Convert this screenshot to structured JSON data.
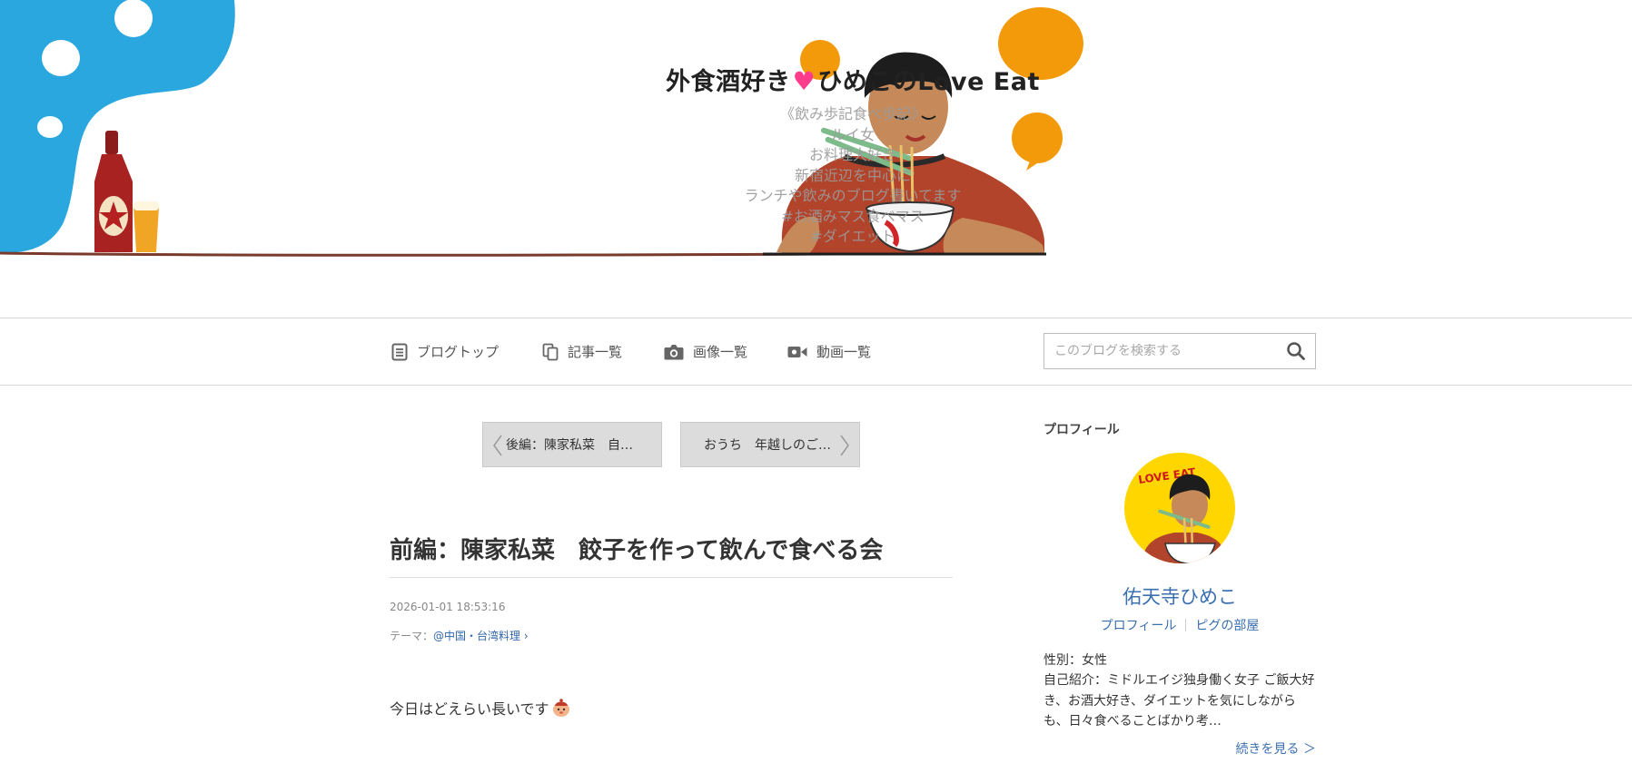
{
  "header": {
    "title_before": "外食酒好き",
    "title_heart": "♥",
    "title_after": "ひめこのLove Eat",
    "description_lines": [
      "《飲み歩記食べ歩記》",
      "ルイ女",
      "お料理大好き",
      "新宿近辺を中心に",
      "ランチや飲みのブログ書いてます",
      "#お酒みマス食べマス",
      "#ダイエット"
    ]
  },
  "nav": {
    "items": [
      {
        "label": "ブログトップ",
        "icon": "document-icon"
      },
      {
        "label": "記事一覧",
        "icon": "copy-icon"
      },
      {
        "label": "画像一覧",
        "icon": "camera-icon"
      },
      {
        "label": "動画一覧",
        "icon": "video-icon"
      }
    ],
    "search": {
      "placeholder": "このブログを検索する",
      "icon": "search-icon"
    }
  },
  "pager": {
    "prev_label": "後編：陳家私菜　自…",
    "next_label": "おうち　年越しのご…"
  },
  "article": {
    "title": "前編：陳家私菜　餃子を作って飲んで食べる会",
    "date": "2026-01-01 18:53:16",
    "theme_label": "テーマ：",
    "theme_value": "@中国・台湾料理",
    "theme_chevron": "›",
    "body_first_line": "今日はどえらい長いです"
  },
  "sidebar": {
    "profile_heading": "プロフィール",
    "name": "佑天寺ひめこ",
    "links": [
      "プロフィール",
      "ピグの部屋"
    ],
    "gender": "性別：女性",
    "intro": "自己紹介：ミドルエイジ独身働く女子 ご飯大好き、お酒大好き、ダイエットを気にしながらも、日々食べることばかり考…",
    "more_label": "続きを見る ＞",
    "avatar_text": "LOVE EAT"
  },
  "colors": {
    "accent_blue": "#2aa7df",
    "accent_orange": "#f39a0b",
    "link": "#3a6fb0",
    "heart": "#ff3c8c",
    "avatar_bg": "#ffd600",
    "shirt": "#b2442b"
  }
}
